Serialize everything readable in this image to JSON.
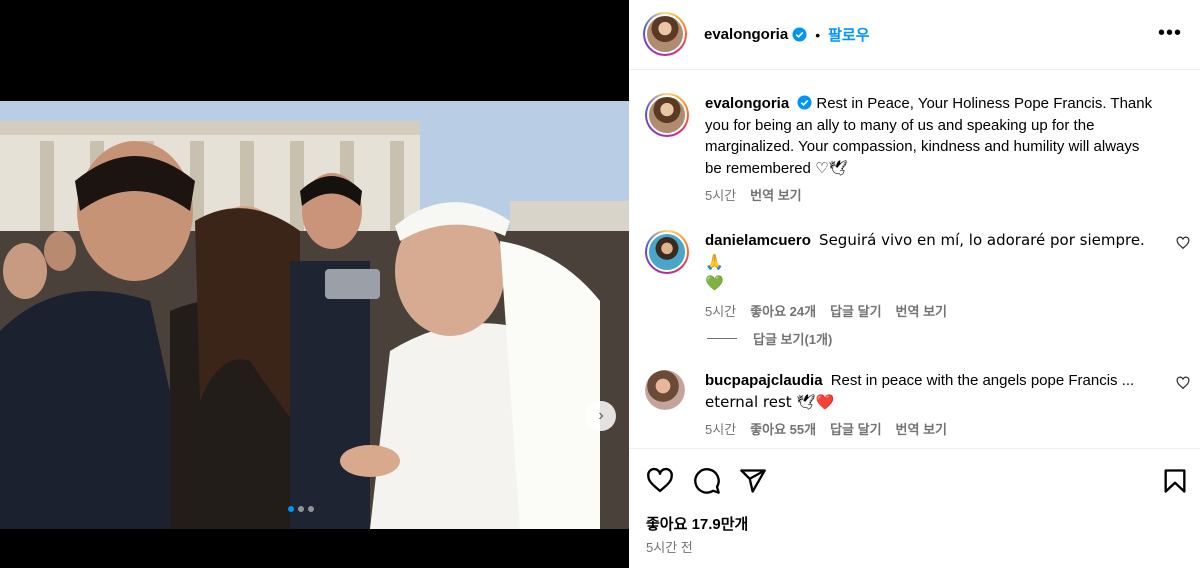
{
  "post": {
    "author": "evalongoria",
    "follow_label": "팔로우",
    "bullet": "•",
    "more_label": "•••",
    "next_label": "›"
  },
  "caption": {
    "username": "evalongoria",
    "text": "Rest in Peace, Your Holiness Pope Francis. Thank you for being an ally to many of us and speaking up for the marginalized. Your compassion, kindness and humility will always be remembered",
    "emoji": "♡🕊",
    "time": "5시간",
    "translate": "번역 보기"
  },
  "comments": [
    {
      "username": "danielamcuero",
      "text": "Seguirá vivo en mí, lo adoraré por siempre. 🙏",
      "emoji_line": "💚",
      "time": "5시간",
      "likes": "좋아요 24개",
      "reply": "답글 달기",
      "translate": "번역 보기",
      "view_replies": "답글 보기(1개)"
    },
    {
      "username": "bucpapajclaudia",
      "text": "Rest in peace with the angels pope Francis ...",
      "line2": "eternal rest 🕊❤️",
      "time": "5시간",
      "likes": "좋아요 55개",
      "reply": "답글 달기",
      "translate": "번역 보기"
    }
  ],
  "footer": {
    "likes": "좋아요 17.9만개",
    "time": "5시간 전"
  },
  "icons": [
    "verified-icon",
    "more-options-icon",
    "heart-icon",
    "comment-icon",
    "share-icon",
    "bookmark-icon",
    "chevron-right-icon"
  ],
  "colors": {
    "accent": "#0095f6",
    "muted": "#737373",
    "heart_green": "#1fbf3f",
    "heart_red": "#e0245e"
  },
  "carousel": {
    "slide_count": 3,
    "active_index": 0
  }
}
